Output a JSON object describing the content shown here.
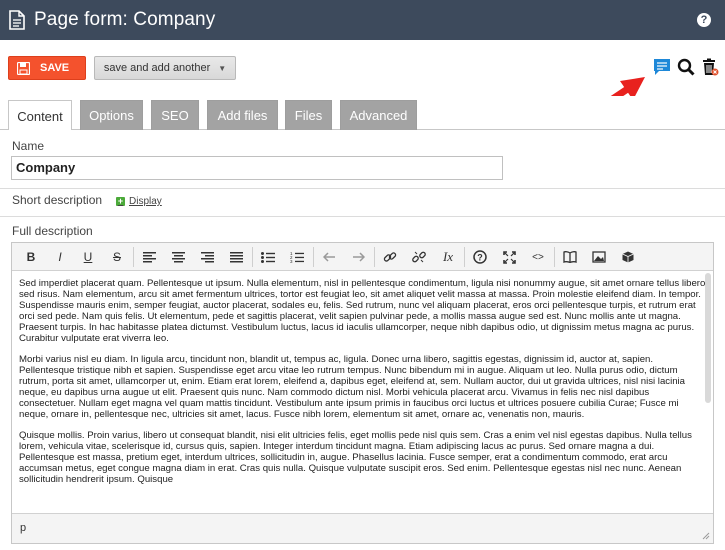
{
  "header": {
    "title": "Page form: Company",
    "help_label": "?"
  },
  "toolbar": {
    "save_label": "SAVE",
    "save_and_add_label": "save and add another",
    "caret": "▼"
  },
  "tabs": [
    {
      "label": "Content"
    },
    {
      "label": "Options"
    },
    {
      "label": "SEO"
    },
    {
      "label": "Add files"
    },
    {
      "label": "Files"
    },
    {
      "label": "Advanced"
    }
  ],
  "form": {
    "name_label": "Name",
    "name_value": "Company",
    "short_description_label": "Short description",
    "display_label": "Display",
    "full_description_label": "Full description"
  },
  "editor": {
    "toolbar": {
      "bold": "B",
      "italic": "I",
      "underline": "U",
      "strike": "S",
      "clear_format": "Ix",
      "code": "<>"
    },
    "paragraphs": [
      "Sed imperdiet placerat quam. Pellentesque ut ipsum. Nulla elementum, nisl in pellentesque condimentum, ligula nisi nonummy augue, sit amet ornare tellus libero sed risus. Nam elementum, arcu sit amet fermentum ultrices, tortor est feugiat leo, sit amet aliquet velit massa at massa. Proin molestie eleifend diam. In tempor. Suspendisse mauris enim, semper feugiat, auctor placerat, sodales eu, felis. Sed rutrum, nunc vel aliquam placerat, eros orci pellentesque turpis, et rutrum erat orci sed pede. Nam quis felis. Ut elementum, pede et sagittis placerat, velit sapien pulvinar pede, a mollis massa augue sed est. Nunc mollis ante ut magna. Praesent turpis. In hac habitasse platea dictumst. Vestibulum luctus, lacus id iaculis ullamcorper, neque nibh dapibus odio, ut dignissim metus magna ac purus. Curabitur vulputate erat viverra leo.",
      "Morbi varius nisl eu diam. In ligula arcu, tincidunt non, blandit ut, tempus ac, ligula. Donec urna libero, sagittis egestas, dignissim id, auctor at, sapien. Pellentesque tristique nibh et sapien. Suspendisse eget arcu vitae leo rutrum tempus. Nunc bibendum mi in augue. Aliquam ut leo. Nulla purus odio, dictum rutrum, porta sit amet, ullamcorper ut, enim. Etiam erat lorem, eleifend a, dapibus eget, eleifend at, sem. Nullam auctor, dui ut gravida ultrices, nisl nisi lacinia neque, eu dapibus urna augue ut elit. Praesent quis nunc. Nam commodo dictum nisl. Morbi vehicula placerat arcu. Vivamus in felis nec nisl dapibus consectetuer. Nullam eget magna vel quam mattis tincidunt. Vestibulum ante ipsum primis in faucibus orci luctus et ultrices posuere cubilia Curae; Fusce mi neque, ornare in, pellentesque nec, ultricies sit amet, lacus. Fusce nibh lorem, elementum sit amet, ornare ac, venenatis non, mauris.",
      "Quisque mollis. Proin varius, libero ut consequat blandit, nisi elit ultricies felis, eget mollis pede nisl quis sem. Cras a enim vel nisl egestas dapibus. Nulla tellus lorem, vehicula vitae, scelerisque id, cursus quis, sapien. Integer interdum tincidunt magna. Etiam adipiscing lacus ac purus. Sed ornare magna a dui. Pellentesque est massa, pretium eget, interdum ultrices, sollicitudin in, augue. Phasellus lacinia. Fusce semper, erat a condimentum commodo, erat arcu accumsan metus, eget congue magna diam in erat. Cras quis nulla. Quisque vulputate suscipit eros. Sed enim. Pellentesque egestas nisl nec nunc. Aenean sollicitudin hendrerit ipsum. Quisque"
    ],
    "status_path": "p"
  },
  "colors": {
    "header_bg": "#3d4a5c",
    "save_bg": "#f4522d",
    "tab_inactive_bg": "#a3a3a3",
    "comments_icon": "#1e88d8",
    "arrow": "#e8211e"
  },
  "icons": {
    "page": "document-icon",
    "help": "help-icon",
    "comments": "comments-icon",
    "preview": "search-icon",
    "delete": "trash-icon"
  }
}
